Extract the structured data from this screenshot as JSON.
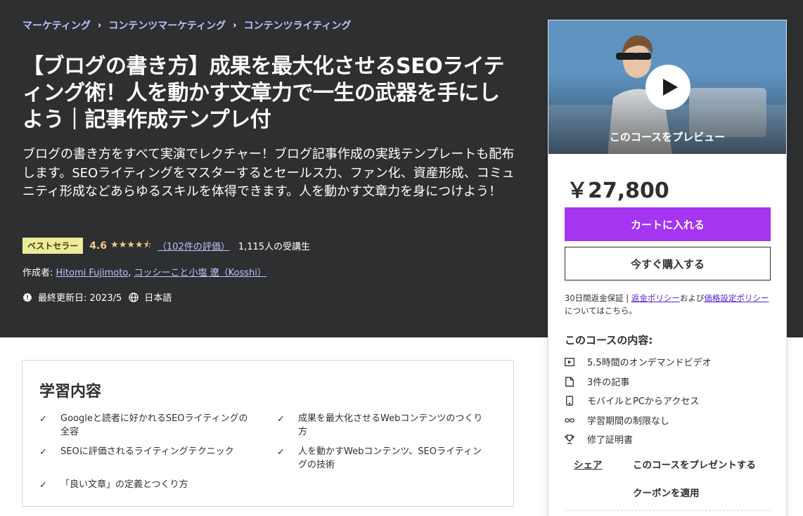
{
  "breadcrumb": {
    "items": [
      "マーケティング",
      "コンテンツマーケティング",
      "コンテンツライティング"
    ]
  },
  "course": {
    "title": "【ブログの書き方】成果を最大化させるSEOライティング術！人を動かす文章力で一生の武器を手にしよう｜記事作成テンプレ付",
    "subtitle": "ブログの書き方をすべて実演でレクチャー！ブログ記事作成の実践テンプレートも配布します。SEOライティングをマスターするとセールス力、ファン化、資産形成、コミュニティ形成などあらゆるスキルを体得できます。人を動かす文章力を身につけよう！",
    "badge": "ベストセラー",
    "rating": "4.6",
    "rating_value": 4.6,
    "reviews": "（102件の評価）",
    "students": "1,115人の受講生",
    "creators_label": "作成者: ",
    "creator_1": "Hitomi Fujimoto",
    "creator_sep": ", ",
    "creator_2": "コッシーこと小塩 遼（Kosshi）",
    "updated": "最終更新日: 2023/5",
    "language": "日本語"
  },
  "learn": {
    "heading": "学習内容",
    "items": [
      "Googleと読者に好かれるSEOライティングの全容",
      "成果を最大化させるWebコンテンツのつくり方",
      "SEOに評価されるライティングテクニック",
      "人を動かすWebコンテンツ、SEOライティングの技術",
      "「良い文章」の定義とつくり方"
    ]
  },
  "sidebar": {
    "preview_label": "このコースをプレビュー",
    "price": "￥27,800",
    "cart_button": "カートに入れる",
    "buy_button": "今すぐ購入する",
    "guarantee_text": "30日間返金保証 | ",
    "refund_policy": "返金ポリシー",
    "and_text": "および",
    "pricing_policy": "価格設定ポリシー",
    "tail_text": "についてはこちら。",
    "includes_title": "このコースの内容:",
    "includes": [
      "5.5時間のオンデマンドビデオ",
      "3件の記事",
      "モバイルとPCからアクセス",
      "学習期間の制限なし",
      "修了証明書"
    ],
    "share": "シェア",
    "gift": "このコースをプレゼントする",
    "coupon": "クーポンを適用"
  },
  "colors": {
    "hero_bg": "#2d2f31",
    "link_light": "#c0c4fc",
    "star": "#f3ca8c",
    "badge_bg": "#eceb98",
    "accent_purple": "#a435f0",
    "link_purple": "#5624d0"
  },
  "icons": {
    "breadcrumb_separator": "chevron-right-icon",
    "updated": "alert-badge-icon",
    "language": "globe-icon",
    "check": "check-icon",
    "play": "play-icon",
    "includes": [
      "video-icon",
      "file-icon",
      "mobile-icon",
      "infinity-icon",
      "trophy-icon"
    ]
  }
}
